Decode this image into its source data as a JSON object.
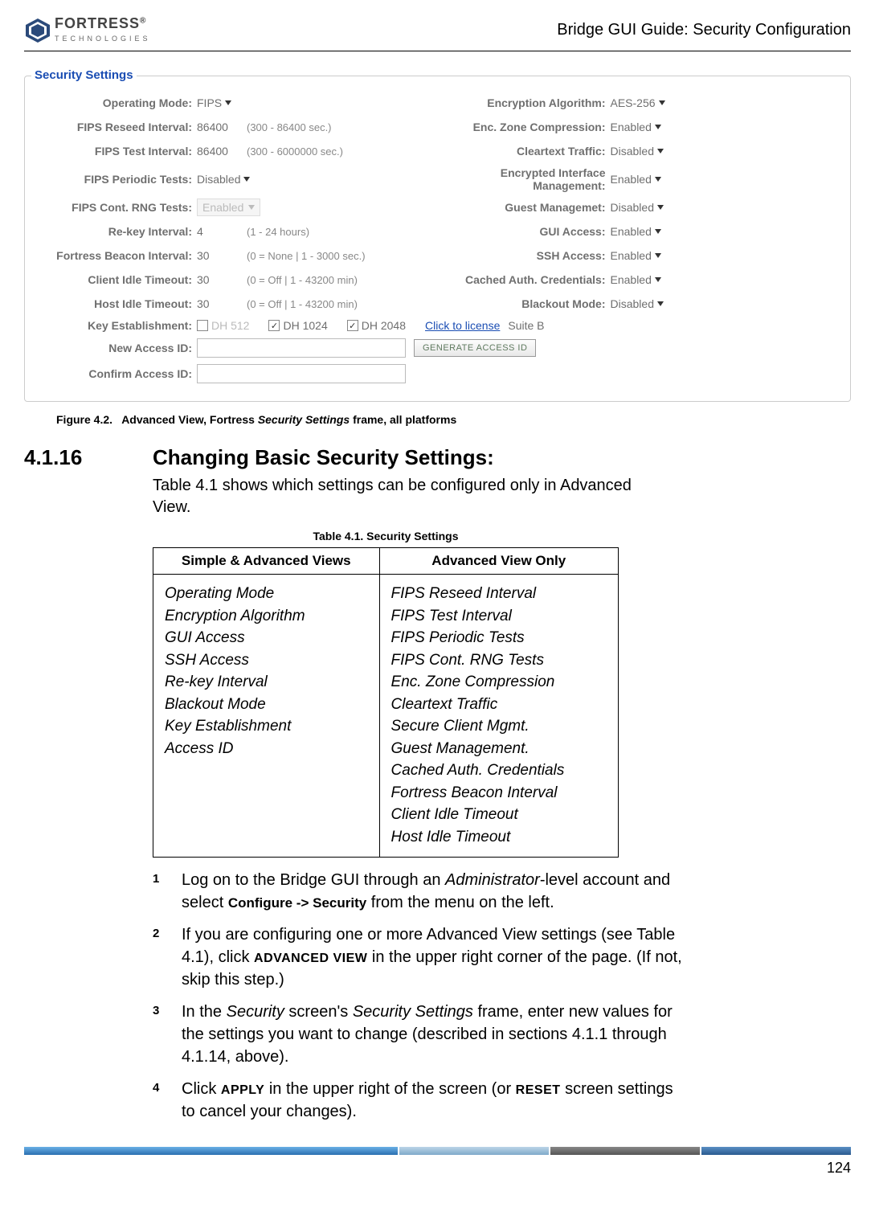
{
  "header": {
    "logo_main": "FORTRESS",
    "logo_reg": "®",
    "logo_sub": "TECHNOLOGIES",
    "doc_title": "Bridge GUI Guide: Security Configuration"
  },
  "fieldset": {
    "legend": "Security Settings",
    "left": [
      {
        "label": "Operating Mode:",
        "value": "FIPS",
        "type": "select"
      },
      {
        "label": "FIPS Reseed Interval:",
        "value": "86400",
        "hint": "(300 - 86400 sec.)",
        "type": "num"
      },
      {
        "label": "FIPS Test Interval:",
        "value": "86400",
        "hint": "(300 - 6000000 sec.)",
        "type": "num"
      },
      {
        "label": "FIPS Periodic Tests:",
        "value": "Disabled",
        "type": "select"
      },
      {
        "label": "FIPS Cont. RNG Tests:",
        "value": "Enabled",
        "type": "disabled-select"
      },
      {
        "label": "Re-key Interval:",
        "value": "4",
        "hint": "(1 - 24 hours)",
        "type": "num"
      },
      {
        "label": "Fortress Beacon Interval:",
        "value": "30",
        "hint": "(0 = None | 1 - 3000 sec.)",
        "type": "num"
      },
      {
        "label": "Client Idle Timeout:",
        "value": "30",
        "hint": "(0 = Off | 1 - 43200 min)",
        "type": "num"
      },
      {
        "label": "Host Idle Timeout:",
        "value": "30",
        "hint": "(0 = Off | 1 - 43200 min)",
        "type": "num"
      }
    ],
    "right": [
      {
        "label": "Encryption Algorithm:",
        "value": "AES-256",
        "type": "select"
      },
      {
        "label": "Enc. Zone Compression:",
        "value": "Enabled",
        "type": "select"
      },
      {
        "label": "Cleartext Traffic:",
        "value": "Disabled",
        "type": "select"
      },
      {
        "label": "Encrypted Interface Management:",
        "value": "Enabled",
        "type": "select"
      },
      {
        "label": "Guest Managemet:",
        "value": "Disabled",
        "type": "select"
      },
      {
        "label": "GUI Access:",
        "value": "Enabled",
        "type": "select"
      },
      {
        "label": "SSH Access:",
        "value": "Enabled",
        "type": "select"
      },
      {
        "label": "Cached Auth. Credentials:",
        "value": "Enabled",
        "type": "select"
      },
      {
        "label": "Blackout Mode:",
        "value": "Disabled",
        "type": "select"
      }
    ],
    "key_establishment": {
      "label": "Key Establishment:",
      "options": [
        {
          "text": "DH 512",
          "checked": false,
          "disabled": true
        },
        {
          "text": "DH 1024",
          "checked": true,
          "disabled": false
        },
        {
          "text": "DH 2048",
          "checked": true,
          "disabled": false
        }
      ],
      "link_text": "Click to license",
      "suite_b": "Suite B"
    },
    "new_access_id_label": "New Access ID:",
    "confirm_access_id_label": "Confirm Access ID:",
    "generate_btn": "GENERATE ACCESS ID"
  },
  "figure_caption": {
    "prefix": "Figure 4.2.",
    "text_a": "Advanced View, Fortress ",
    "ital": "Security Settings",
    "text_b": " frame, all platforms"
  },
  "section": {
    "num": "4.1.16",
    "title": "Changing Basic Security Settings:",
    "intro": "Table 4.1 shows which settings can be configured only in Advanced View."
  },
  "table": {
    "caption": "Table 4.1. Security Settings",
    "headers": [
      "Simple & Advanced Views",
      "Advanced View Only"
    ],
    "col1": [
      "Operating Mode",
      "Encryption Algorithm",
      "GUI Access",
      "SSH Access",
      "Re-key Interval",
      "Blackout Mode",
      "Key Establishment",
      "Access ID"
    ],
    "col2": [
      "FIPS Reseed Interval",
      "FIPS Test Interval",
      "FIPS Periodic Tests",
      "FIPS Cont. RNG Tests",
      "Enc. Zone Compression",
      "Cleartext Traffic",
      "Secure Client Mgmt.",
      "Guest Management.",
      "Cached Auth. Credentials",
      "Fortress Beacon Interval",
      "Client Idle Timeout",
      "Host Idle Timeout"
    ]
  },
  "steps": {
    "s1_a": "Log on to the Bridge GUI through an ",
    "s1_ital": "Administrator",
    "s1_b": "-level account and select ",
    "s1_bold": "Configure -> Security",
    "s1_c": " from the menu on the left.",
    "s2_a": "If you are configuring one or more Advanced View settings (see Table 4.1), click ",
    "s2_caps": "ADVANCED VIEW",
    "s2_b": " in the upper right corner of the page. (If not, skip this step.)",
    "s3_a": "In the ",
    "s3_ital1": "Security",
    "s3_b": " screen's ",
    "s3_ital2": "Security Settings",
    "s3_c": " frame, enter new values for the settings you want to change (described in sections 4.1.1 through 4.1.14, above).",
    "s4_a": "Click ",
    "s4_caps1": "APPLY",
    "s4_b": " in the upper right of the screen (or ",
    "s4_caps2": "RESET",
    "s4_c": " screen settings to cancel your changes)."
  },
  "page_number": "124"
}
